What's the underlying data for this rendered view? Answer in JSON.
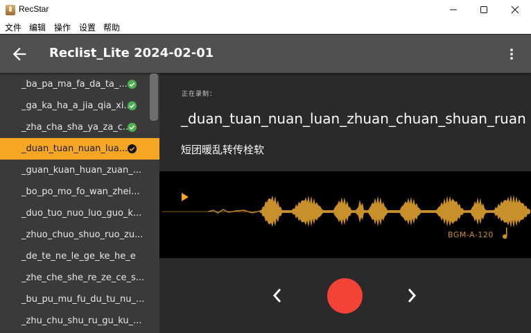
{
  "window": {
    "title": "RecStar",
    "app_icon": "recstar-microphone-icon",
    "controls": [
      "minimize-icon",
      "maximize-icon",
      "close-icon"
    ]
  },
  "menu": [
    "文件",
    "编辑",
    "操作",
    "设置",
    "帮助"
  ],
  "appbar": {
    "title": "Reclist_Lite 2024-02-01",
    "back_icon": "arrow-back-icon",
    "more_icon": "more-vert-icon"
  },
  "sentences": [
    {
      "label": "_ba_pa_ma_fa_da_ta_...",
      "status": "done"
    },
    {
      "label": "_ga_ka_ha_a_jia_qia_xi...",
      "status": "done"
    },
    {
      "label": "_zha_cha_sha_ya_za_c...",
      "status": "done"
    },
    {
      "label": "_duan_tuan_nuan_lua...",
      "status": "selected-done"
    },
    {
      "label": "_guan_kuan_huan_zuan_...",
      "status": "none"
    },
    {
      "label": "_bo_po_mo_fo_wan_zhei...",
      "status": "none"
    },
    {
      "label": "_duo_tuo_nuo_luo_guo_k...",
      "status": "none"
    },
    {
      "label": "_zhuo_chuo_shuo_ruo_zu...",
      "status": "none"
    },
    {
      "label": "_de_te_ne_le_ge_ke_he_e",
      "status": "none"
    },
    {
      "label": "_zhe_che_she_re_ze_ce_s...",
      "status": "none"
    },
    {
      "label": "_bu_pu_mu_fu_du_tu_nu_...",
      "status": "none"
    },
    {
      "label": "_zhu_chu_shu_ru_gu_ku_...",
      "status": "none"
    }
  ],
  "current": {
    "status_label": "正在录制：",
    "name": "_duan_tuan_nuan_luan_zhuan_chuan_shuan_ruan",
    "text": "短团暖乱转传栓软"
  },
  "player": {
    "bgm_label": "BGM-A-120",
    "play_icon": "play-icon",
    "note_icon": "music-note-icon"
  },
  "controls": {
    "prev_icon": "chevron-left-icon",
    "record_icon": "record-button",
    "next_icon": "chevron-right-icon"
  },
  "colors": {
    "accent": "#f5a623",
    "check_done": "#4caf50",
    "record": "#f44236",
    "waveform": "#c8902a",
    "appbar": "#505050",
    "sidebar": "#3a3a3a"
  }
}
